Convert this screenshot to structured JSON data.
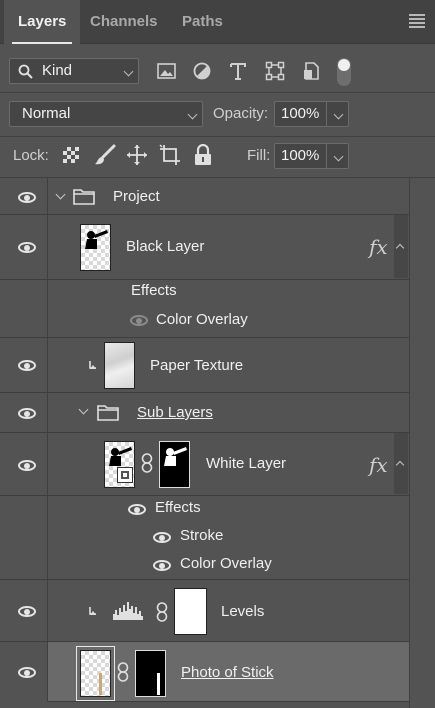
{
  "tabs": {
    "layers": "Layers",
    "channels": "Channels",
    "paths": "Paths"
  },
  "filter": {
    "kind": "Kind"
  },
  "blend": {
    "mode": "Normal",
    "opacity_label": "Opacity:",
    "opacity": "100%"
  },
  "lock": {
    "label": "Lock:",
    "fill_label": "Fill:",
    "fill": "100%"
  },
  "layers": {
    "project": "Project",
    "black_layer": "Black Layer",
    "black_effects": "Effects",
    "black_color_overlay": "Color Overlay",
    "paper_texture": "Paper Texture",
    "sub_layers": "Sub Layers",
    "white_layer": "White Layer",
    "white_effects": "Effects",
    "white_stroke": "Stroke",
    "white_color_overlay": "Color Overlay",
    "levels": "Levels",
    "photo": "Photo of Stick"
  },
  "fx_label": "fx",
  "colors": {
    "panel": "#535353",
    "tabbar": "#424242",
    "selected_row": "#6a6a6a"
  }
}
